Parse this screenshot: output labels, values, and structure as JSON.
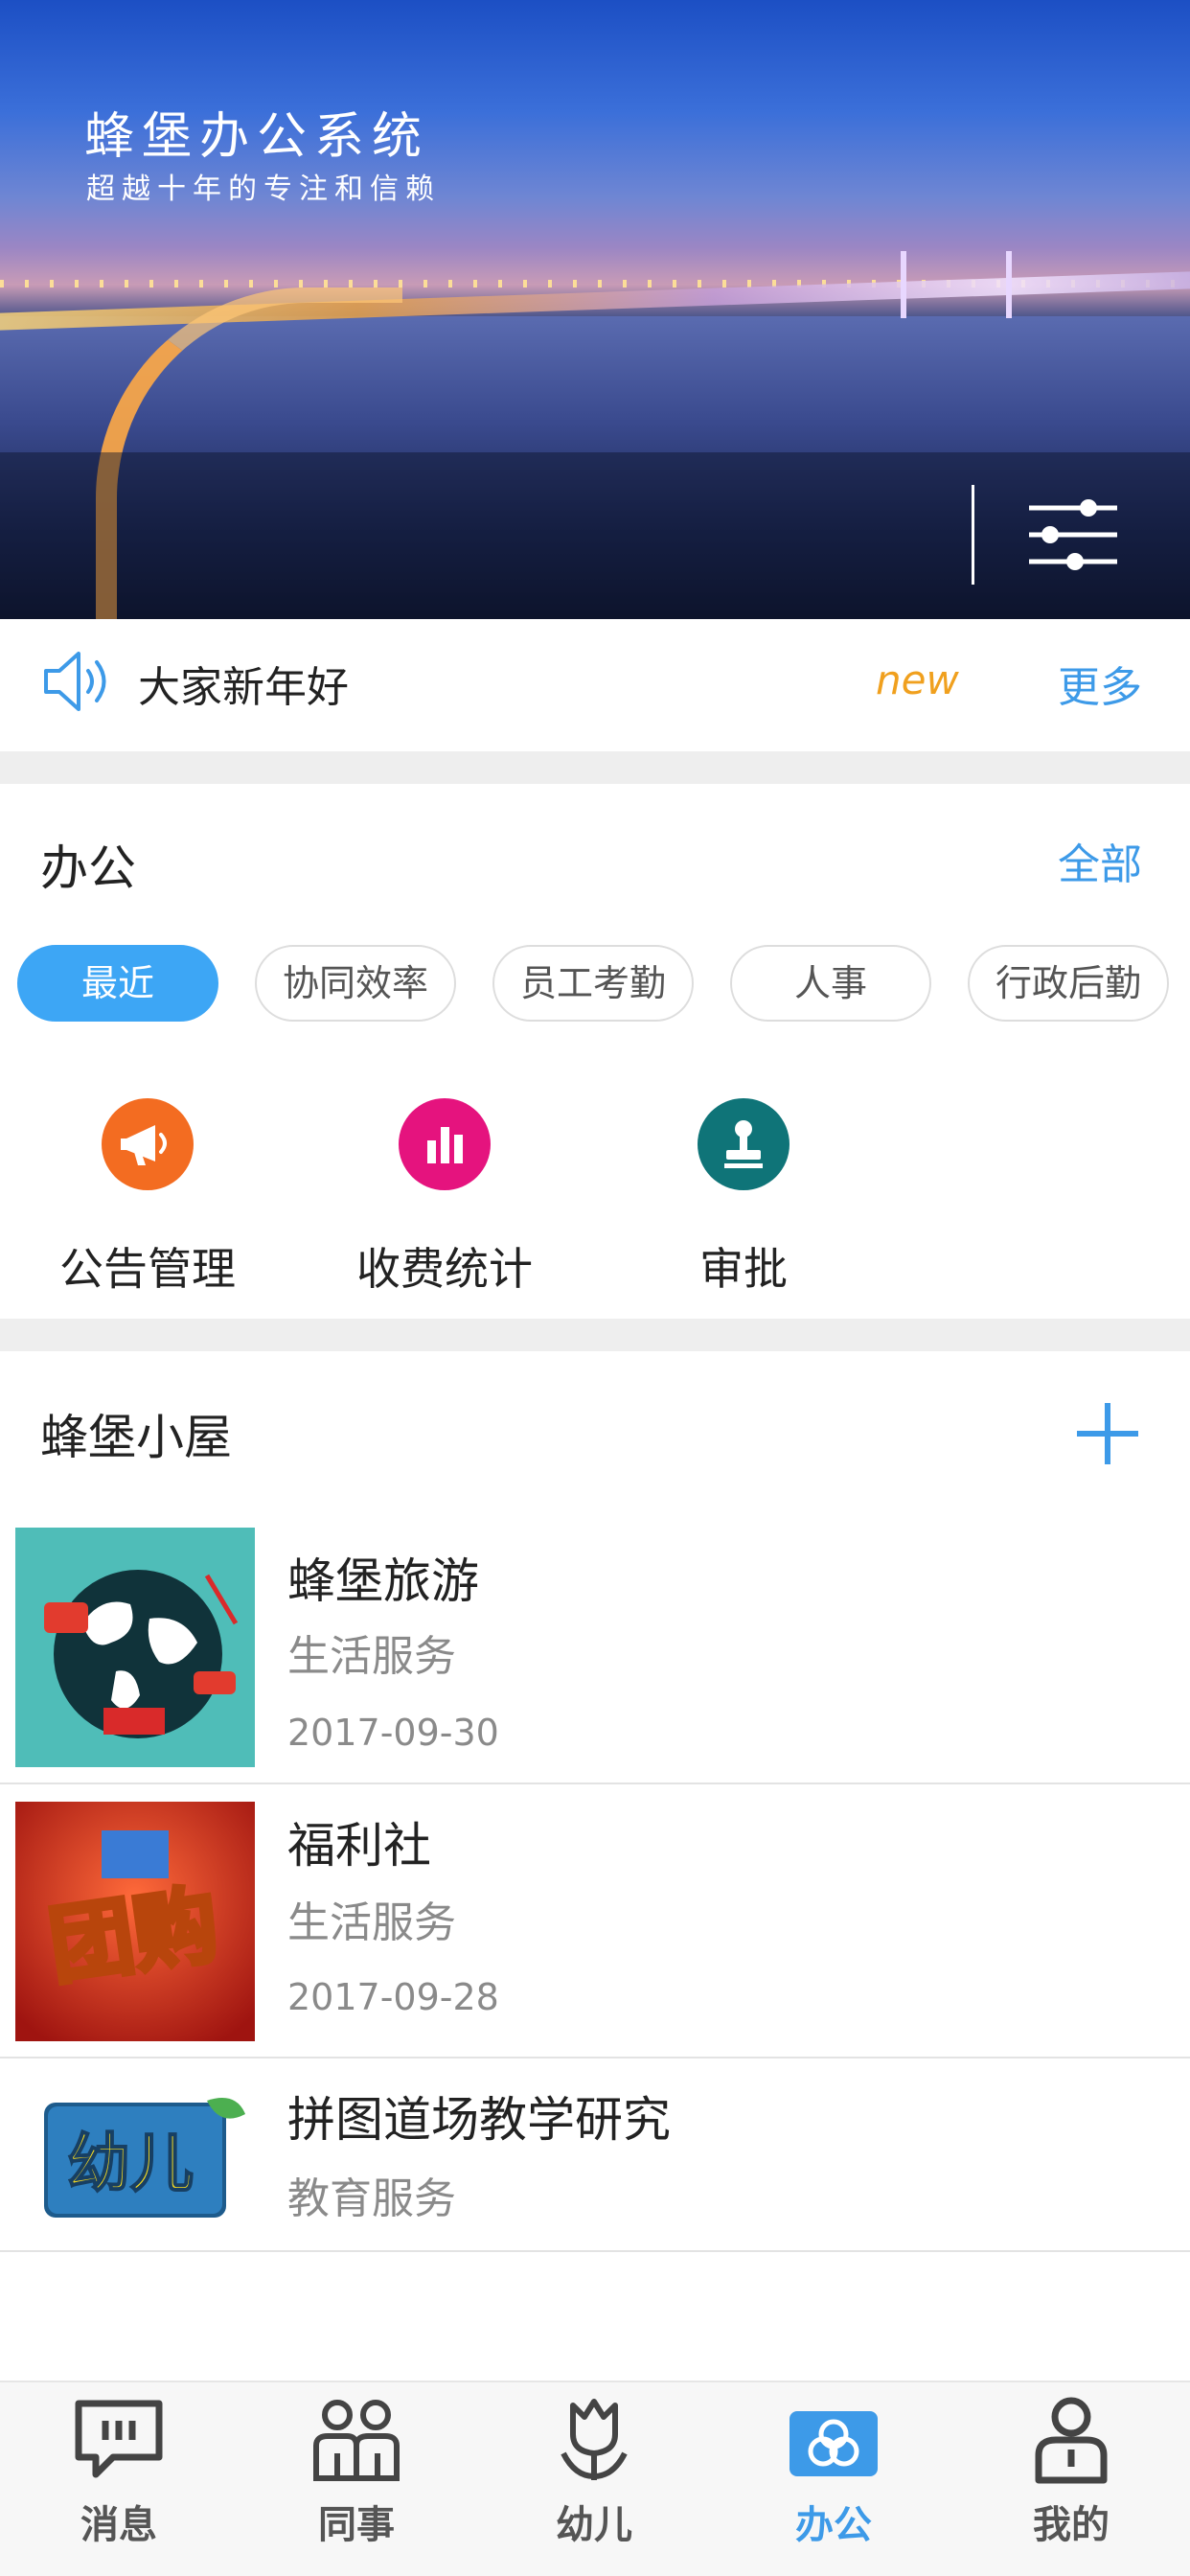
{
  "banner": {
    "title": "蜂堡办公系统",
    "subtitle": "超越十年的专注和信赖"
  },
  "notice": {
    "text": "大家新年好",
    "new_tag": "new",
    "more_label": "更多"
  },
  "office": {
    "title": "办公",
    "all_label": "全部",
    "chips": [
      "最近",
      "协同效率",
      "员工考勤",
      "人事",
      "行政后勤"
    ],
    "active_chip": "最近",
    "apps": [
      {
        "label": "公告管理",
        "icon": "megaphone-icon",
        "color": "#f36c21"
      },
      {
        "label": "收费统计",
        "icon": "bar-chart-icon",
        "color": "#e5137e"
      },
      {
        "label": "审批",
        "icon": "stamp-icon",
        "color": "#0f7478"
      }
    ]
  },
  "house": {
    "title": "蜂堡小屋",
    "items": [
      {
        "title": "蜂堡旅游",
        "category": "生活服务",
        "date": "2017-09-30",
        "icon": "travel-globe-image"
      },
      {
        "title": "福利社",
        "category": "生活服务",
        "date": "2017-09-28",
        "icon": "group-buy-image",
        "image_text": "团购"
      },
      {
        "title": "拼图道场教学研究",
        "category": "教育服务",
        "icon": "kids-logo-image",
        "image_text": "幼儿"
      }
    ]
  },
  "tabs": [
    {
      "label": "消息",
      "icon": "chat-icon"
    },
    {
      "label": "同事",
      "icon": "colleagues-icon"
    },
    {
      "label": "幼儿",
      "icon": "tulip-icon"
    },
    {
      "label": "办公",
      "icon": "office-icon",
      "active": true
    },
    {
      "label": "我的",
      "icon": "profile-icon"
    }
  ],
  "colors": {
    "accent": "#3d9ae8",
    "new_tag": "#f0a01e",
    "chip_active": "#3da6f5"
  }
}
